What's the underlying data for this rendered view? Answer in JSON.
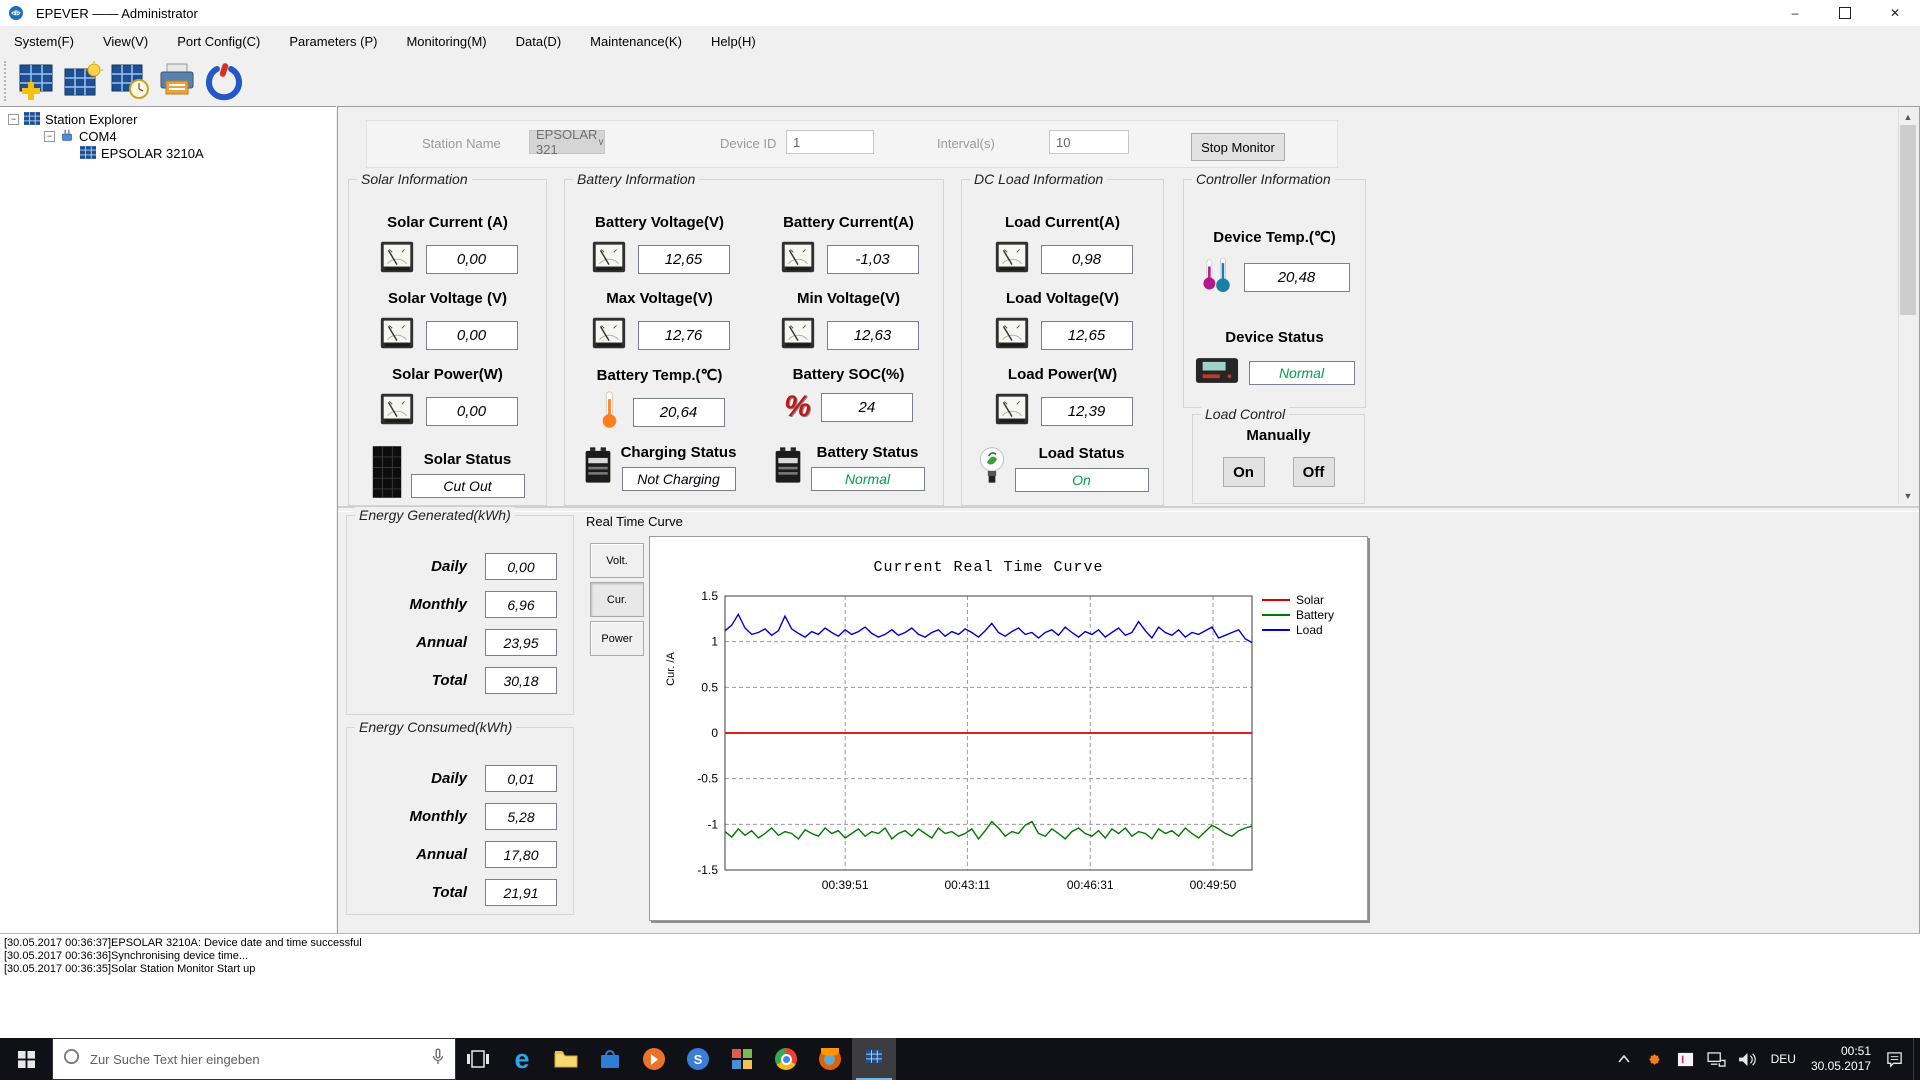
{
  "window": {
    "title": "EPEVER —— Administrator"
  },
  "menu": {
    "items": [
      {
        "label": "System(F)"
      },
      {
        "label": "View(V)"
      },
      {
        "label": "Port Config(C)"
      },
      {
        "label": "Parameters (P)"
      },
      {
        "label": "Monitoring(M)"
      },
      {
        "label": "Data(D)"
      },
      {
        "label": "Maintenance(K)"
      },
      {
        "label": "Help(H)"
      }
    ]
  },
  "toolbar": {
    "icons": [
      {
        "name": "add-station-icon"
      },
      {
        "name": "station-monitor-icon"
      },
      {
        "name": "station-clock-icon"
      },
      {
        "name": "print-icon"
      },
      {
        "name": "power-icon"
      }
    ]
  },
  "tree": {
    "items": [
      {
        "label": "Station Explorer"
      },
      {
        "label": "COM4"
      },
      {
        "label": "EPSOLAR 3210A"
      }
    ]
  },
  "station_bar": {
    "station_name_label": "Station Name",
    "station_name_value": "EPSOLAR 321",
    "device_id_label": "Device ID",
    "device_id_value": "1",
    "interval_label": "Interval(s)",
    "interval_value": "10",
    "stop_button_label": "Stop Monitor"
  },
  "panels": {
    "solar": {
      "title": "Solar Information",
      "rows": [
        {
          "label": "Solar Current (A)",
          "value": "0,00"
        },
        {
          "label": "Solar Voltage (V)",
          "value": "0,00"
        },
        {
          "label": "Solar Power(W)",
          "value": "0,00"
        }
      ],
      "status": {
        "label": "Solar Status",
        "value": "Cut Out",
        "color": "#000000"
      }
    },
    "battery": {
      "title": "Battery Information",
      "rows": [
        {
          "label": "Battery Voltage(V)",
          "value": "12,65"
        },
        {
          "label": "Battery Current(A)",
          "value": "-1,03"
        },
        {
          "label": "Max Voltage(V)",
          "value": "12,76"
        },
        {
          "label": "Min Voltage(V)",
          "value": "12,63"
        },
        {
          "label": "Battery Temp.(℃)",
          "value": "20,64"
        },
        {
          "label": "Battery SOC(%)",
          "value": "24"
        }
      ],
      "statuses": [
        {
          "label": "Charging Status",
          "value": "Not Charging",
          "color": "#000000"
        },
        {
          "label": "Battery Status",
          "value": "Normal",
          "color": "#00a14b"
        }
      ]
    },
    "dc_load": {
      "title": "DC Load Information",
      "rows": [
        {
          "label": "Load Current(A)",
          "value": "0,98"
        },
        {
          "label": "Load Voltage(V)",
          "value": "12,65"
        },
        {
          "label": "Load Power(W)",
          "value": "12,39"
        }
      ],
      "status": {
        "label": "Load Status",
        "value": "On",
        "color": "#00a14b"
      }
    },
    "controller": {
      "title": "Controller Information",
      "temp_label": "Device Temp.(℃)",
      "temp_value": "20,48",
      "status_label": "Device Status",
      "status_value": "Normal",
      "status_color": "#00a14b"
    },
    "load_control": {
      "title": "Load Control",
      "mode_label": "Manually",
      "on_label": "On",
      "off_label": "Off"
    }
  },
  "energy_generated": {
    "title": "Energy Generated(kWh)",
    "rows": [
      {
        "label": "Daily",
        "value": "0,00"
      },
      {
        "label": "Monthly",
        "value": "6,96"
      },
      {
        "label": "Annual",
        "value": "23,95"
      },
      {
        "label": "Total",
        "value": "30,18"
      }
    ]
  },
  "energy_consumed": {
    "title": "Energy Consumed(kWh)",
    "rows": [
      {
        "label": "Daily",
        "value": "0,01"
      },
      {
        "label": "Monthly",
        "value": "5,28"
      },
      {
        "label": "Annual",
        "value": "17,80"
      },
      {
        "label": "Total",
        "value": "21,91"
      }
    ]
  },
  "realtime": {
    "section_title": "Real Time Curve",
    "tabs": [
      {
        "label": "Volt."
      },
      {
        "label": "Cur."
      },
      {
        "label": "Power"
      }
    ]
  },
  "chart_data": {
    "type": "line",
    "title": "Current Real Time Curve",
    "xlabel": "",
    "ylabel": "Cur. /A",
    "ylim": [
      -1.5,
      1.5
    ],
    "yticks": [
      1.5,
      1,
      0.5,
      0,
      -0.5,
      -1,
      -1.5
    ],
    "xtick_labels": [
      "00:39:51",
      "00:43:11",
      "00:46:31",
      "00:49:50"
    ],
    "xtick_fractions": [
      0.228,
      0.46,
      0.693,
      0.926
    ],
    "grid": "dashed",
    "legend_position": "right",
    "series": [
      {
        "name": "Solar",
        "color": "#dd0000",
        "values": [
          0,
          0
        ]
      },
      {
        "name": "Battery",
        "color": "#007700",
        "values": [
          -1.08,
          -1.14,
          -1.05,
          -1.12,
          -1.07,
          -1.15,
          -1.1,
          -1.04,
          -1.12,
          -1.08,
          -1.1,
          -1.16,
          -1.06,
          -1.1,
          -1.13,
          -1.04,
          -1.1,
          -1.07,
          -1.15,
          -1.1,
          -1.05,
          -1.13,
          -1.08,
          -1.1,
          -1.04,
          -1.16,
          -1.1,
          -1.07,
          -1.13,
          -1.05,
          -1.1,
          -1.15,
          -1.04,
          -1.1,
          -1.08,
          -1.13,
          -1.1,
          -1.05,
          -1.16,
          -1.07,
          -0.97,
          -1.04,
          -1.13,
          -1.08,
          -1.1,
          -1.01,
          -0.97,
          -1.1,
          -1.13,
          -1.05,
          -1.1,
          -1.16,
          -1.08,
          -1.04,
          -1.1,
          -1.13,
          -1.07,
          -1.15,
          -1.05,
          -1.1,
          -1.04,
          -1.13,
          -1.08,
          -1.1,
          -1.16,
          -1.05,
          -1.1,
          -1.07,
          -1.13,
          -1.04,
          -1.1,
          -1.15,
          -1.08,
          -1.01,
          -1.05,
          -1.1,
          -1.13,
          -1.07,
          -1.04,
          -1.02
        ]
      },
      {
        "name": "Load",
        "color": "#0000cc",
        "values": [
          1.12,
          1.18,
          1.3,
          1.15,
          1.08,
          1.1,
          1.14,
          1.07,
          1.12,
          1.28,
          1.14,
          1.09,
          1.05,
          1.11,
          1.08,
          1.15,
          1.1,
          1.06,
          1.13,
          1.08,
          1.11,
          1.16,
          1.09,
          1.05,
          1.08,
          1.13,
          1.07,
          1.1,
          1.15,
          1.08,
          1.05,
          1.1,
          1.13,
          1.06,
          1.11,
          1.08,
          1.14,
          1.1,
          1.05,
          1.12,
          1.2,
          1.1,
          1.06,
          1.11,
          1.15,
          1.08,
          1.1,
          1.04,
          1.1,
          1.13,
          1.07,
          1.16,
          1.1,
          1.05,
          1.11,
          1.08,
          1.13,
          1.05,
          1.1,
          1.15,
          1.07,
          1.1,
          1.22,
          1.12,
          1.04,
          1.16,
          1.1,
          1.07,
          1.13,
          1.05,
          1.1,
          1.08,
          1.12,
          1.16,
          1.04,
          1.07,
          1.1,
          1.13,
          1.03,
          0.99
        ]
      }
    ]
  },
  "log": {
    "lines": [
      "[30.05.2017 00:36:37]EPSOLAR 3210A: Device date and time successful",
      "[30.05.2017 00:36:36]Synchronising device time...",
      "[30.05.2017 00:36:35]Solar Station Monitor Start up"
    ]
  },
  "taskbar": {
    "search_placeholder": "Zur Suche Text hier eingeben",
    "language": "DEU",
    "time": "00:51",
    "date": "30.05.2017"
  }
}
